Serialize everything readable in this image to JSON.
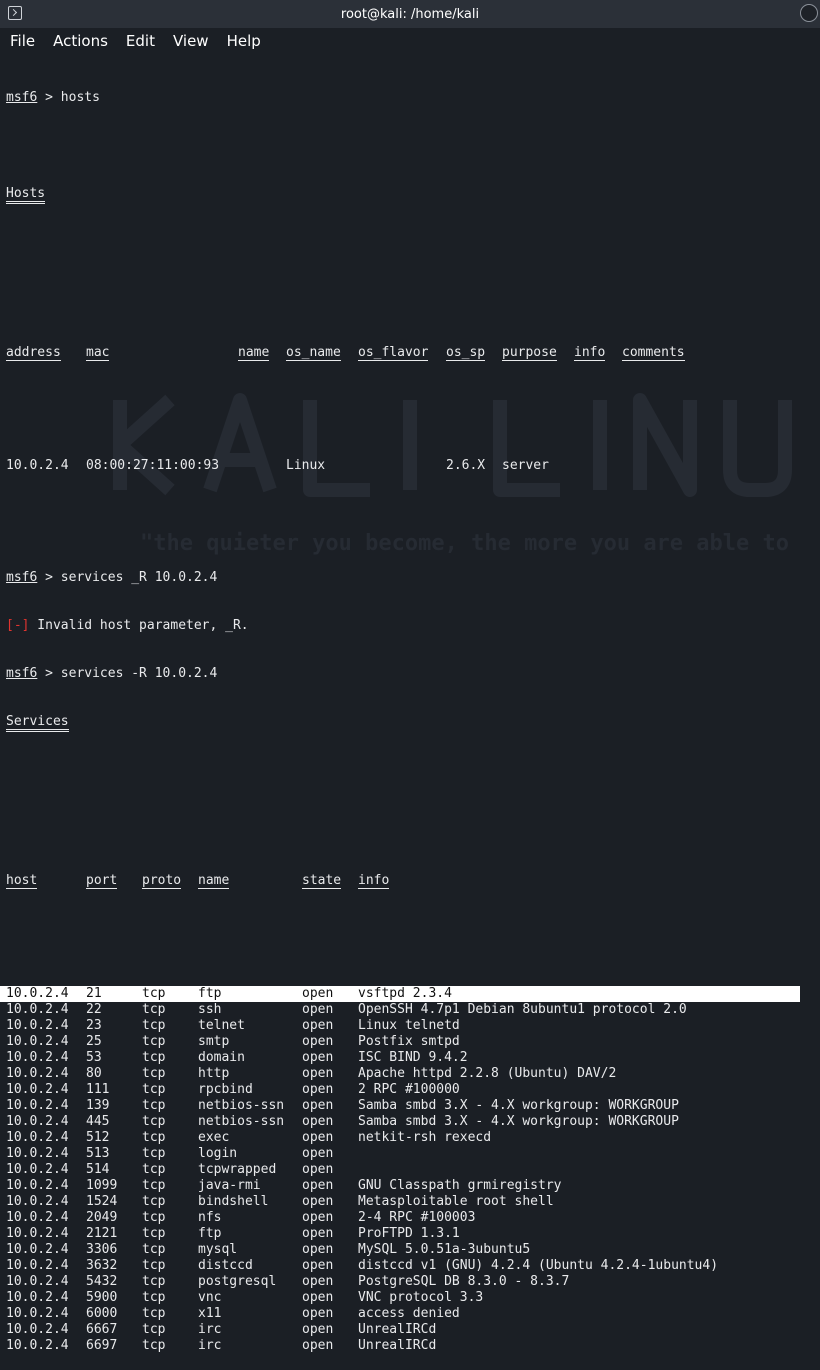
{
  "window": {
    "title": "root@kali: /home/kali"
  },
  "menu": [
    "File",
    "Actions",
    "Edit",
    "View",
    "Help"
  ],
  "terminal": {
    "prompt": "msf6",
    "cmd1": " > hosts",
    "hosts_title": "Hosts",
    "hosts_headers": [
      "address",
      "mac",
      "name",
      "os_name",
      "os_flavor",
      "os_sp",
      "purpose",
      "info",
      "comments"
    ],
    "hosts_rows": [
      [
        "10.0.2.4",
        "08:00:27:11:00:93",
        "",
        "Linux",
        "",
        "2.6.X",
        "server",
        "",
        ""
      ]
    ],
    "cmd2": " > services _R 10.0.2.4",
    "err_tag": "[-]",
    "err_msg": " Invalid host parameter, _R.",
    "cmd3": " > services -R 10.0.2.4",
    "services_title": "Services",
    "services_headers": [
      "host",
      "port",
      "proto",
      "name",
      "state",
      "info"
    ],
    "services_rows": [
      [
        "10.0.2.4",
        "21",
        "tcp",
        "ftp",
        "open",
        "vsftpd 2.3.4"
      ],
      [
        "10.0.2.4",
        "22",
        "tcp",
        "ssh",
        "open",
        "OpenSSH 4.7p1 Debian 8ubuntu1 protocol 2.0"
      ],
      [
        "10.0.2.4",
        "23",
        "tcp",
        "telnet",
        "open",
        "Linux telnetd"
      ],
      [
        "10.0.2.4",
        "25",
        "tcp",
        "smtp",
        "open",
        "Postfix smtpd"
      ],
      [
        "10.0.2.4",
        "53",
        "tcp",
        "domain",
        "open",
        "ISC BIND 9.4.2"
      ],
      [
        "10.0.2.4",
        "80",
        "tcp",
        "http",
        "open",
        "Apache httpd 2.2.8 (Ubuntu) DAV/2"
      ],
      [
        "10.0.2.4",
        "111",
        "tcp",
        "rpcbind",
        "open",
        "2 RPC #100000"
      ],
      [
        "10.0.2.4",
        "139",
        "tcp",
        "netbios-ssn",
        "open",
        "Samba smbd 3.X - 4.X workgroup: WORKGROUP"
      ],
      [
        "10.0.2.4",
        "445",
        "tcp",
        "netbios-ssn",
        "open",
        "Samba smbd 3.X - 4.X workgroup: WORKGROUP"
      ],
      [
        "10.0.2.4",
        "512",
        "tcp",
        "exec",
        "open",
        "netkit-rsh rexecd"
      ],
      [
        "10.0.2.4",
        "513",
        "tcp",
        "login",
        "open",
        ""
      ],
      [
        "10.0.2.4",
        "514",
        "tcp",
        "tcpwrapped",
        "open",
        ""
      ],
      [
        "10.0.2.4",
        "1099",
        "tcp",
        "java-rmi",
        "open",
        "GNU Classpath grmiregistry"
      ],
      [
        "10.0.2.4",
        "1524",
        "tcp",
        "bindshell",
        "open",
        "Metasploitable root shell"
      ],
      [
        "10.0.2.4",
        "2049",
        "tcp",
        "nfs",
        "open",
        "2-4 RPC #100003"
      ],
      [
        "10.0.2.4",
        "2121",
        "tcp",
        "ftp",
        "open",
        "ProFTPD 1.3.1"
      ],
      [
        "10.0.2.4",
        "3306",
        "tcp",
        "mysql",
        "open",
        "MySQL 5.0.51a-3ubuntu5"
      ],
      [
        "10.0.2.4",
        "3632",
        "tcp",
        "distccd",
        "open",
        "distccd v1 (GNU) 4.2.4 (Ubuntu 4.2.4-1ubuntu4)"
      ],
      [
        "10.0.2.4",
        "5432",
        "tcp",
        "postgresql",
        "open",
        "PostgreSQL DB 8.3.0 - 8.3.7"
      ],
      [
        "10.0.2.4",
        "5900",
        "tcp",
        "vnc",
        "open",
        "VNC protocol 3.3"
      ],
      [
        "10.0.2.4",
        "6000",
        "tcp",
        "x11",
        "open",
        "access denied"
      ],
      [
        "10.0.2.4",
        "6667",
        "tcp",
        "irc",
        "open",
        "UnrealIRCd"
      ],
      [
        "10.0.2.4",
        "6697",
        "tcp",
        "irc",
        "open",
        "UnrealIRCd"
      ]
    ],
    "highlighted_row": 0
  },
  "colors": {
    "background": "#1b1f25",
    "text": "#e9eaec",
    "error": "#e0342f",
    "titlebar": "#2b3038"
  }
}
